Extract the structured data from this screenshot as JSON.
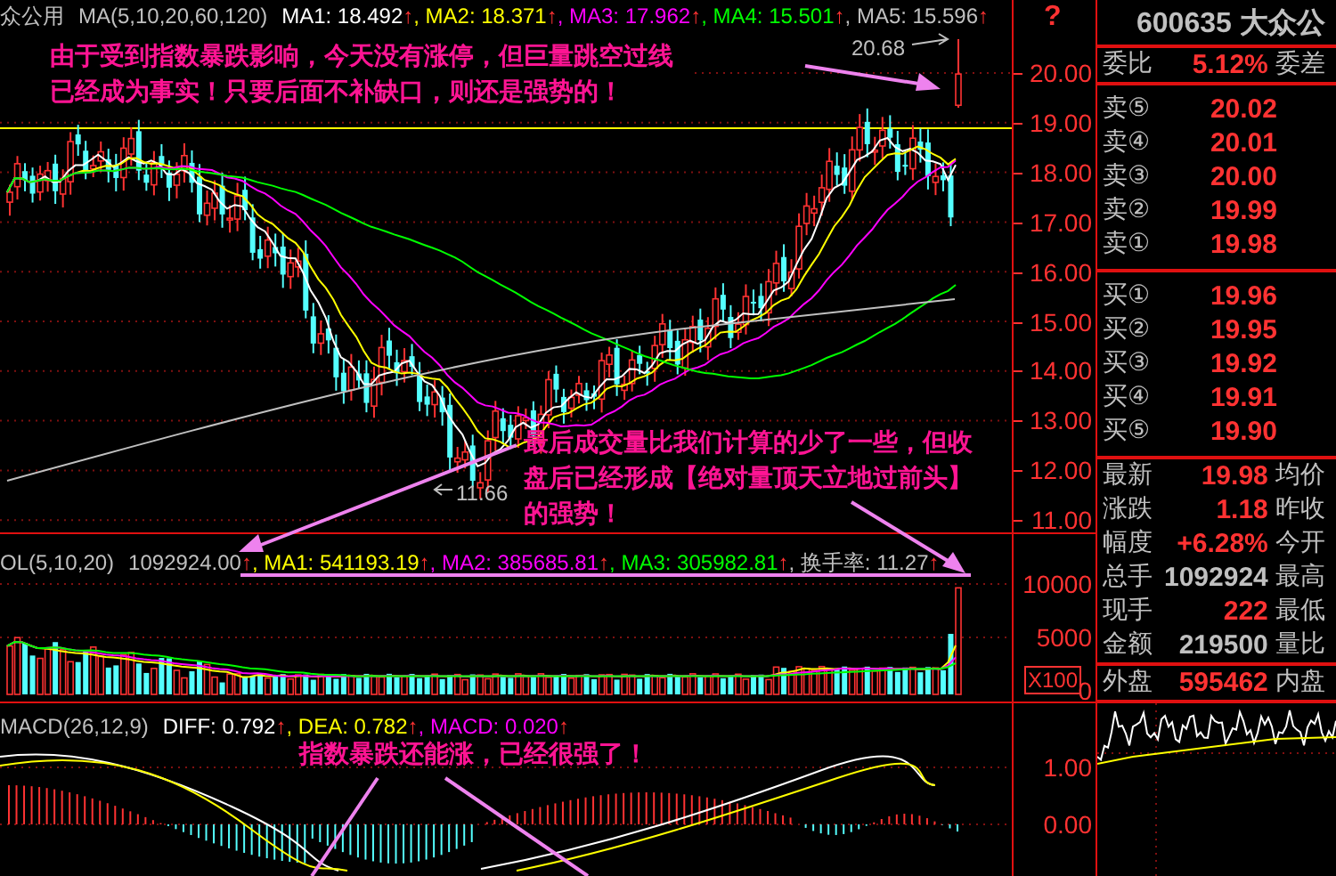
{
  "price_panel": {
    "name": "众公用",
    "indicator": "MA(5,10,20,60,120)",
    "mas": [
      {
        "label": "MA1: 18.492",
        "color": "#ffffff",
        "trend": "↑"
      },
      {
        "label": ", MA2: 18.371",
        "color": "#ffff00",
        "trend": "↑"
      },
      {
        "label": ", MA3: 17.962",
        "color": "#ff00ff",
        "trend": "↑"
      },
      {
        "label": ", MA4: 15.501",
        "color": "#00ff00",
        "trend": "↑"
      },
      {
        "label": ", MA5: 15.596",
        "color": "#c0c0c0",
        "trend": "↑"
      }
    ],
    "high_label": "20.68",
    "low_label": "11.66",
    "notes": [
      {
        "lines": [
          "由于受到指数暴跌影响，今天没有涨停，但巨量跳空过线",
          "已经成为事实！只要后面不补缺口，则还是强势的！"
        ]
      },
      {
        "lines": [
          "最后成交量比我们计算的少了一些，但收",
          "盘后已经形成【绝对量顶天立地过前头】",
          "的强势！"
        ]
      }
    ],
    "help_mark": "?",
    "axis": [
      "20.00",
      "19.00",
      "18.00",
      "17.00",
      "16.00",
      "15.00",
      "14.00",
      "13.00",
      "12.00",
      "11.00"
    ]
  },
  "volume_panel": {
    "indicator": "OL(5,10,20)",
    "total": "1092924.00",
    "total_trend": "↑",
    "mas": [
      {
        "label": ", MA1: 541193.19",
        "color": "#ffff00",
        "trend": "↑"
      },
      {
        "label": ", MA2: 385685.81",
        "color": "#ff00ff",
        "trend": "↑"
      },
      {
        "label": ", MA3: 305982.81",
        "color": "#00ff00",
        "trend": "↑"
      },
      {
        "label": ", 换手率: 11.27",
        "color": "#c0c0c0",
        "trend": "↑"
      }
    ],
    "axis": [
      "10000",
      "5000",
      "0"
    ],
    "scale": "X100"
  },
  "macd_panel": {
    "indicator": "MACD(26,12,9)",
    "values": [
      {
        "label": "DIFF: 0.792",
        "color": "#ffffff",
        "trend": "↑"
      },
      {
        "label": ", DEA: 0.782",
        "color": "#ffff00",
        "trend": "↑"
      },
      {
        "label": ", MACD: 0.020",
        "color": "#ff00ff",
        "trend": "↑"
      }
    ],
    "note": "指数暴跌还能涨，已经很强了！",
    "axis": [
      "1.00",
      "0.00"
    ]
  },
  "quote": {
    "title": "600635 大众公",
    "ratio": {
      "label": "委比",
      "value": "5.12%",
      "label2": "委差"
    },
    "sells": [
      {
        "label": "卖⑤",
        "price": "20.02"
      },
      {
        "label": "卖④",
        "price": "20.01"
      },
      {
        "label": "卖③",
        "price": "20.00"
      },
      {
        "label": "卖②",
        "price": "19.99"
      },
      {
        "label": "卖①",
        "price": "19.98"
      }
    ],
    "buys": [
      {
        "label": "买①",
        "price": "19.96"
      },
      {
        "label": "买②",
        "price": "19.95"
      },
      {
        "label": "买③",
        "price": "19.92"
      },
      {
        "label": "买④",
        "price": "19.91"
      },
      {
        "label": "买⑤",
        "price": "19.90"
      }
    ],
    "stats": [
      {
        "label": "最新",
        "value": "19.98",
        "color": "#ff3232",
        "label2": "均价"
      },
      {
        "label": "涨跌",
        "value": "1.18",
        "color": "#ff3232",
        "label2": "昨收"
      },
      {
        "label": "幅度",
        "value": "+6.28%",
        "color": "#ff3232",
        "label2": "今开"
      },
      {
        "label": "总手",
        "value": "1092924",
        "color": "#c0c0c0",
        "label2": "最高"
      },
      {
        "label": "现手",
        "value": "222",
        "color": "#ff3232",
        "label2": "最低"
      },
      {
        "label": "金额",
        "value": "219500",
        "color": "#c0c0c0",
        "label2": "量比"
      }
    ],
    "outer": {
      "label": "外盘",
      "value": "595462",
      "label2": "内盘"
    }
  }
}
